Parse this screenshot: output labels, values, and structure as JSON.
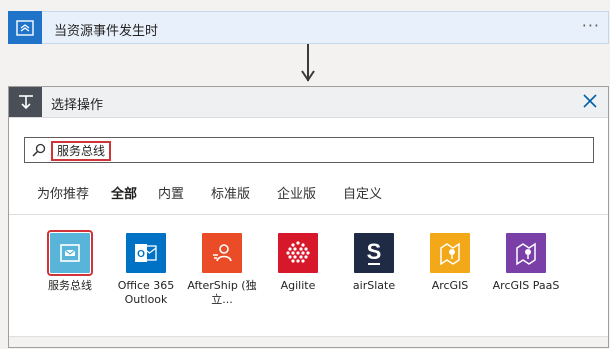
{
  "trigger": {
    "title": "当资源事件发生时",
    "more": "···",
    "icon": "event-grid-icon",
    "color": "#1f74c9"
  },
  "action": {
    "title": "选择操作",
    "icon": "operation-icon",
    "close_icon": "close-icon",
    "search": {
      "value": "服务总线",
      "icon": "search-icon"
    },
    "tabs": [
      {
        "label": "为你推荐"
      },
      {
        "label": "全部",
        "active": true
      },
      {
        "label": "内置"
      },
      {
        "label": "标准版"
      },
      {
        "label": "企业版"
      },
      {
        "label": "自定义"
      }
    ],
    "connectors": [
      {
        "name": "服务总线",
        "color": "#59b4d9",
        "icon": "service-bus-icon",
        "highlighted": true
      },
      {
        "name": "Office 365 Outlook",
        "color": "#0072c6",
        "icon": "outlook-icon"
      },
      {
        "name": "AfterShip (独立...",
        "color": "#ea4c28",
        "icon": "aftership-icon"
      },
      {
        "name": "Agilite",
        "color": "#d7182a",
        "icon": "agilite-icon"
      },
      {
        "name": "airSlate",
        "color": "#1f2a44",
        "icon": "airslate-icon"
      },
      {
        "name": "ArcGIS",
        "color": "#f2a818",
        "icon": "arcgis-icon"
      },
      {
        "name": "ArcGIS PaaS",
        "color": "#7b3fa8",
        "icon": "arcgis-paas-icon"
      }
    ]
  }
}
